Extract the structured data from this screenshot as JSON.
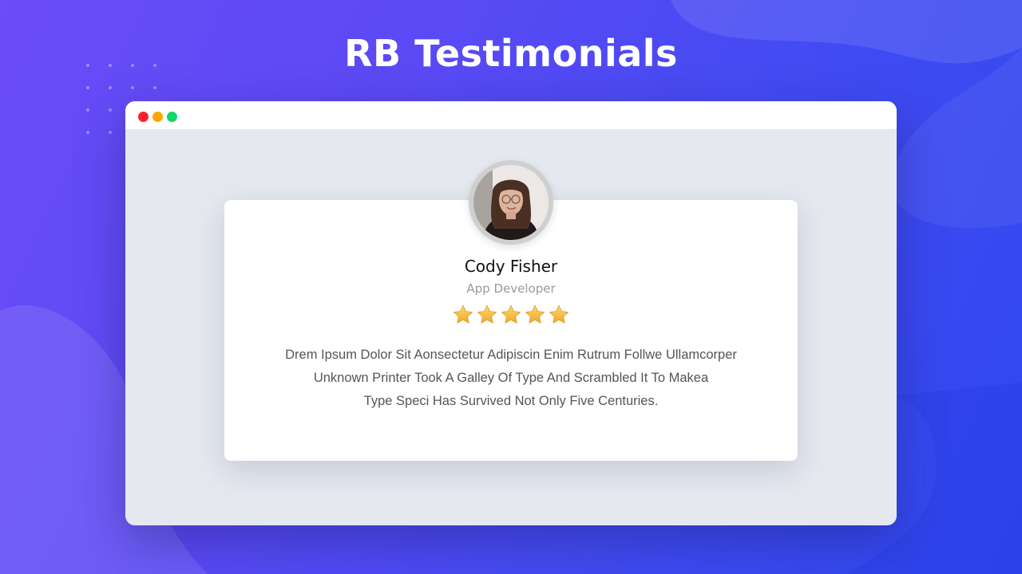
{
  "header": {
    "title": "RB Testimonials"
  },
  "window": {
    "controls": [
      "close",
      "minimize",
      "maximize"
    ]
  },
  "testimonial": {
    "name": "Cody Fisher",
    "role": "App Developer",
    "rating": 5,
    "rating_max": 5,
    "review_lines": [
      "Drem Ipsum Dolor Sit Aonsectetur Adipiscin Enim Rutrum Follwe Ullamcorper",
      "Unknown Printer Took A Galley Of Type And Scrambled It To Makea",
      "Type Speci Has Survived Not Only Five Centuries."
    ]
  },
  "colors": {
    "background_start": "#6b4cf7",
    "background_end": "#2f47ee",
    "window_close": "#ff1f2a",
    "window_minimize": "#ffa500",
    "window_maximize": "#13d66b",
    "star": "#f5b73a"
  }
}
